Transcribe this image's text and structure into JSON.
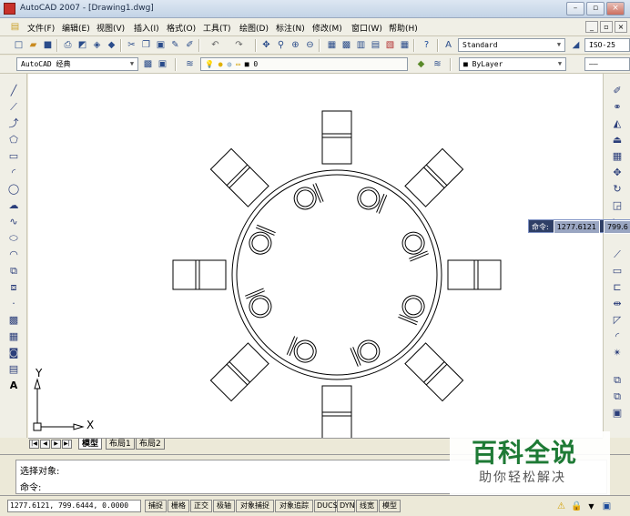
{
  "window": {
    "title": "AutoCAD 2007 - [Drawing1.dwg]",
    "controls": [
      "–",
      "▫",
      "×"
    ]
  },
  "menu": {
    "items": [
      "文件(F)",
      "编辑(E)",
      "视图(V)",
      "插入(I)",
      "格式(O)",
      "工具(T)",
      "绘图(D)",
      "标注(N)",
      "修改(M)",
      "窗口(W)",
      "帮助(H)"
    ],
    "mdi_controls": [
      "_",
      "▫",
      "×"
    ]
  },
  "toolbar1": {
    "text_style": "Standard",
    "dim_style": "ISO-25"
  },
  "toolbar2": {
    "workspace": "AutoCAD 经典",
    "layer_name": "0",
    "color": "ByLayer"
  },
  "ucs": {
    "x_label": "X",
    "y_label": "Y"
  },
  "dynamic_input": {
    "label": "命令:",
    "x_value": "1277.6121",
    "y_value": "799.6"
  },
  "tabs": {
    "nav": [
      "|◀",
      "◀",
      "▶",
      "▶|"
    ],
    "items": [
      "模型",
      "布局1",
      "布局2"
    ]
  },
  "command": {
    "line1": "选择对象:",
    "line2": "命令:"
  },
  "status": {
    "coords": "1277.6121, 799.6444, 0.0000",
    "buttons": [
      "捕捉",
      "栅格",
      "正交",
      "极轴",
      "对象捕捉",
      "对象追踪",
      "DUCS",
      "DYN",
      "线宽",
      "模型"
    ]
  },
  "watermark": {
    "main": "百科全说",
    "sub": "助你轻松解决"
  },
  "colors": {
    "title_bar": "#c3d3e6",
    "chrome": "#ece9d8",
    "canvas": "#ffffff",
    "dyn_bg": "#2f3f66",
    "watermark_green": "#1e7a35"
  }
}
